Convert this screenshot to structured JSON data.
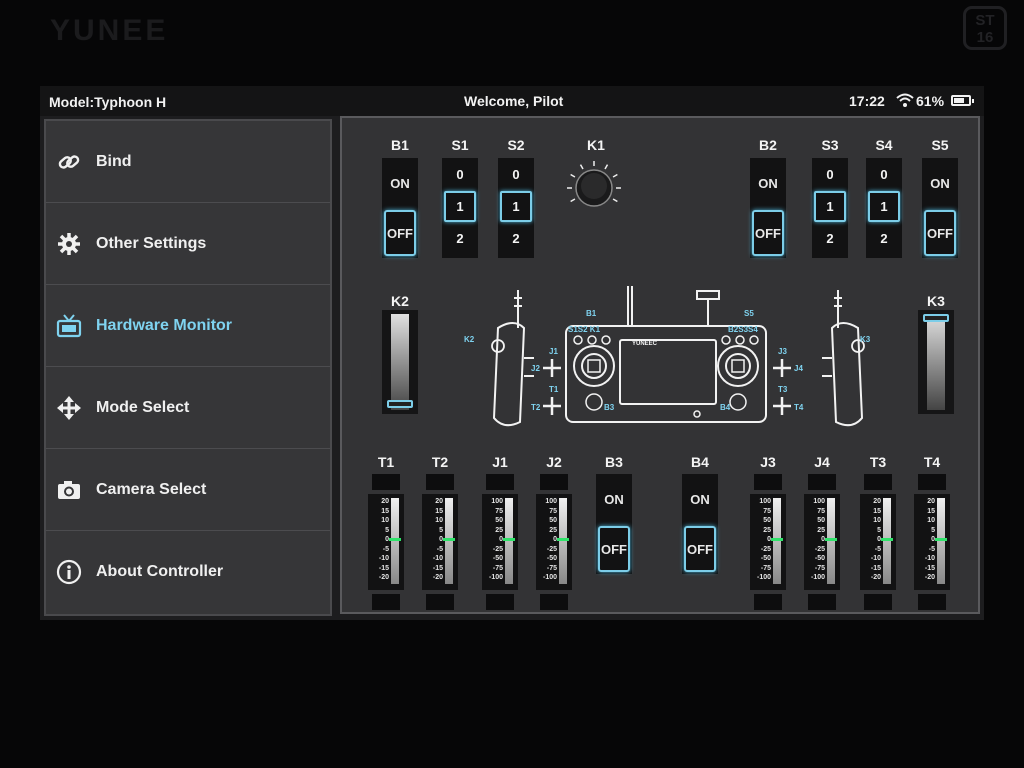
{
  "device": {
    "brand": "YUNEE",
    "model_badge_top": "ST",
    "model_badge_bottom": "16"
  },
  "statusbar": {
    "model": "Model:Typhoon H",
    "welcome": "Welcome, Pilot",
    "time": "17:22",
    "battery": "61%",
    "battery_level": 0.61
  },
  "sidebar": {
    "items": [
      {
        "label": "Bind",
        "icon": "link-icon",
        "active": false
      },
      {
        "label": "Other Settings",
        "icon": "gear-icon",
        "active": false
      },
      {
        "label": "Hardware Monitor",
        "icon": "tv-icon",
        "active": true
      },
      {
        "label": "Mode Select",
        "icon": "move-arrows-icon",
        "active": false
      },
      {
        "label": "Camera Select",
        "icon": "camera-icon",
        "active": false
      },
      {
        "label": "About Controller",
        "icon": "info-icon",
        "active": false
      }
    ]
  },
  "monitor": {
    "top_switches": [
      {
        "label": "B1",
        "type": "button",
        "on": "ON",
        "off": "OFF",
        "state": "OFF"
      },
      {
        "label": "S1",
        "type": "3pos",
        "positions": [
          "0",
          "1",
          "2"
        ],
        "selected": "1"
      },
      {
        "label": "S2",
        "type": "3pos",
        "positions": [
          "0",
          "1",
          "2"
        ],
        "selected": "1"
      },
      {
        "label": "K1",
        "type": "knob"
      },
      {
        "label": "B2",
        "type": "button",
        "on": "ON",
        "off": "OFF",
        "state": "OFF"
      },
      {
        "label": "S3",
        "type": "3pos",
        "positions": [
          "0",
          "1",
          "2"
        ],
        "selected": "1"
      },
      {
        "label": "S4",
        "type": "3pos",
        "positions": [
          "0",
          "1",
          "2"
        ],
        "selected": "1"
      },
      {
        "label": "S5",
        "type": "button",
        "on": "ON",
        "off": "OFF",
        "state": "OFF"
      }
    ],
    "k2": {
      "label": "K2",
      "level": 0.0
    },
    "k3": {
      "label": "K3",
      "level": 1.0
    },
    "diagram_labels": {
      "b1": "B1",
      "s1s2k1": "S1S2 K1",
      "s5": "S5",
      "b2s3s4": "B2S3S4",
      "k2": "K2",
      "k3": "K3",
      "j1": "J1",
      "j2": "J2",
      "t1": "T1",
      "t2": "T2",
      "j3": "J3",
      "j4": "J4",
      "t3": "T3",
      "t4": "T4",
      "b3": "B3",
      "b4": "B4",
      "screen_brand": "YUNEEC"
    },
    "trim_scale": [
      "20",
      "15",
      "10",
      "5",
      "0",
      "-5",
      "-10",
      "-15",
      "-20"
    ],
    "stick_scale": [
      "100",
      "75",
      "50",
      "25",
      "0",
      "-25",
      "-50",
      "-75",
      "-100"
    ],
    "bottom_channels": [
      {
        "label": "T1",
        "type": "trim",
        "value": 0
      },
      {
        "label": "T2",
        "type": "trim",
        "value": 0
      },
      {
        "label": "J1",
        "type": "stick",
        "value": 0
      },
      {
        "label": "J2",
        "type": "stick",
        "value": 0
      },
      {
        "label": "B3",
        "type": "button",
        "on": "ON",
        "off": "OFF",
        "state": "OFF"
      },
      {
        "label": "B4",
        "type": "button",
        "on": "ON",
        "off": "OFF",
        "state": "OFF"
      },
      {
        "label": "J3",
        "type": "stick",
        "value": 0
      },
      {
        "label": "J4",
        "type": "stick",
        "value": 0
      },
      {
        "label": "T3",
        "type": "trim",
        "value": 0
      },
      {
        "label": "T4",
        "type": "trim",
        "value": 0
      }
    ],
    "colors": {
      "accent": "#7fd3f0",
      "indicator": "#2fe36a",
      "panel": "#333335"
    }
  }
}
